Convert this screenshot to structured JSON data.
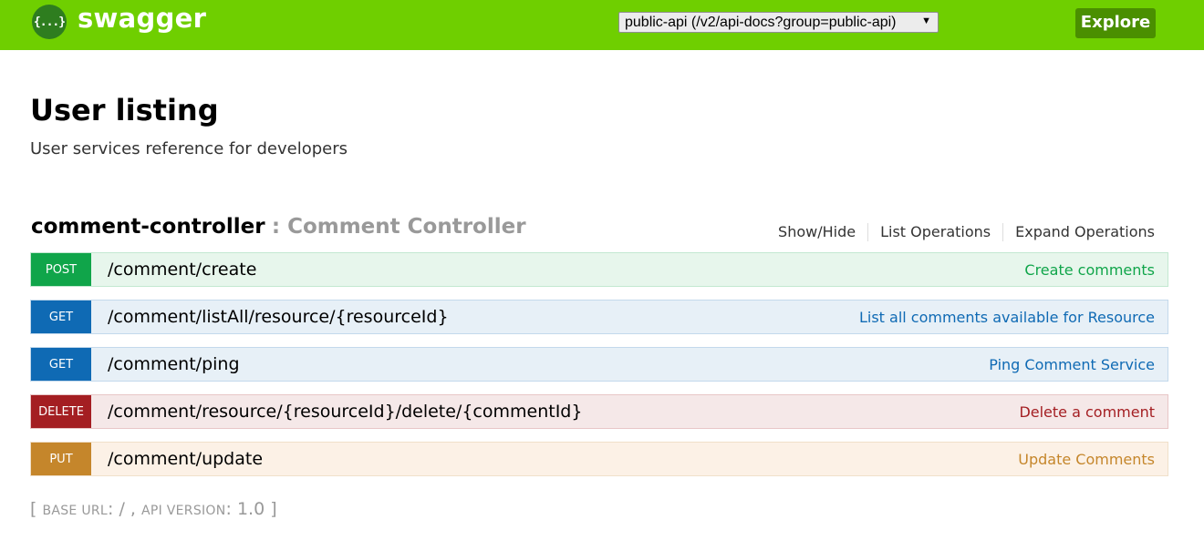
{
  "header": {
    "logo_text": "{...}",
    "brand": "swagger",
    "api_select_value": "public-api (/v2/api-docs?group=public-api)",
    "explore_label": "Explore",
    "bar_color": "#6fcf00"
  },
  "info": {
    "title": "User listing",
    "description": "User services reference for developers"
  },
  "resource": {
    "name": "comment-controller",
    "description": ": Comment Controller",
    "links": {
      "show_hide": "Show/Hide",
      "list_operations": "List Operations",
      "expand_operations": "Expand Operations"
    }
  },
  "operations": [
    {
      "method": "POST",
      "path": "/comment/create",
      "summary": "Create comments",
      "color": "#10a54a"
    },
    {
      "method": "GET",
      "path": "/comment/listAll/resource/{resourceId}",
      "summary": "List all comments available for Resource",
      "color": "#0f6ab4"
    },
    {
      "method": "GET",
      "path": "/comment/ping",
      "summary": "Ping Comment Service",
      "color": "#0f6ab4"
    },
    {
      "method": "DELETE",
      "path": "/comment/resource/{resourceId}/delete/{commentId}",
      "summary": "Delete a comment",
      "color": "#a41e22"
    },
    {
      "method": "PUT",
      "path": "/comment/update",
      "summary": "Update Comments",
      "color": "#c5862b"
    }
  ],
  "footer": {
    "open": "[ ",
    "base_url_label": "BASE URL",
    "base_url_value": ": / , ",
    "api_version_label": "API VERSION",
    "api_version_value": ": 1.0 ]"
  }
}
